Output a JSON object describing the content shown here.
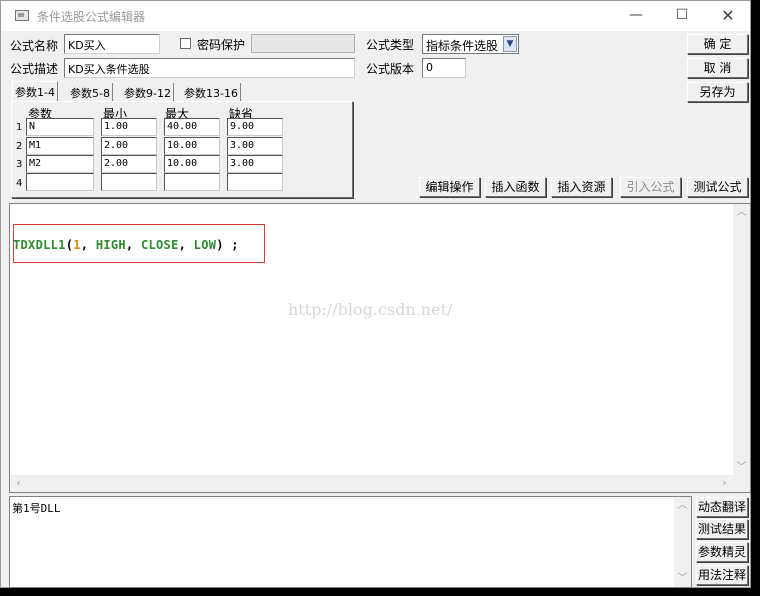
{
  "window": {
    "title": "条件选股公式编辑器",
    "minimize_glyph": "—",
    "maximize_glyph": "☐",
    "close_glyph": "✕"
  },
  "form": {
    "name_label": "公式名称",
    "name_value": "KD买入",
    "password_label": "密码保护",
    "password_value": "",
    "type_label": "公式类型",
    "type_value": "指标条件选股",
    "desc_label": "公式描述",
    "desc_value": "KD买入条件选股",
    "version_label": "公式版本",
    "version_value": "0"
  },
  "buttons": {
    "ok": "确  定",
    "cancel": "取  消",
    "save_as": "另存为",
    "edit_ops": "编辑操作",
    "insert_func": "插入函数",
    "insert_res": "插入资源",
    "import_formula": "引入公式",
    "test_formula": "测试公式"
  },
  "tabs": [
    "参数1-4",
    "参数5-8",
    "参数9-12",
    "参数13-16"
  ],
  "params": {
    "headers": [
      "参数",
      "最小",
      "最大",
      "缺省"
    ],
    "rows": [
      {
        "n": "1",
        "name": "N",
        "min": "1.00",
        "max": "40.00",
        "def": "9.00"
      },
      {
        "n": "2",
        "name": "M1",
        "min": "2.00",
        "max": "10.00",
        "def": "3.00"
      },
      {
        "n": "3",
        "name": "M2",
        "min": "2.00",
        "max": "10.00",
        "def": "3.00"
      },
      {
        "n": "4",
        "name": "",
        "min": "",
        "max": "",
        "def": ""
      }
    ]
  },
  "editor": {
    "code_tokens": [
      {
        "t": "TDXDLL1",
        "c": "g"
      },
      {
        "t": "(",
        "c": "b"
      },
      {
        "t": "1",
        "c": "o"
      },
      {
        "t": ", ",
        "c": "b"
      },
      {
        "t": "HIGH",
        "c": "g"
      },
      {
        "t": ", ",
        "c": "b"
      },
      {
        "t": "CLOSE",
        "c": "g"
      },
      {
        "t": ", ",
        "c": "b"
      },
      {
        "t": "LOW",
        "c": "g"
      },
      {
        "t": ") ;",
        "c": "b"
      }
    ],
    "watermark": "http://blog.csdn.net/"
  },
  "bottom": {
    "text": "第1号DLL"
  },
  "side_buttons": [
    "动态翻译",
    "测试结果",
    "参数精灵",
    "用法注释"
  ],
  "colors": {
    "keyword": "#2e8b2e",
    "number": "#e08a12",
    "highlight_border": "#e03a3a"
  }
}
